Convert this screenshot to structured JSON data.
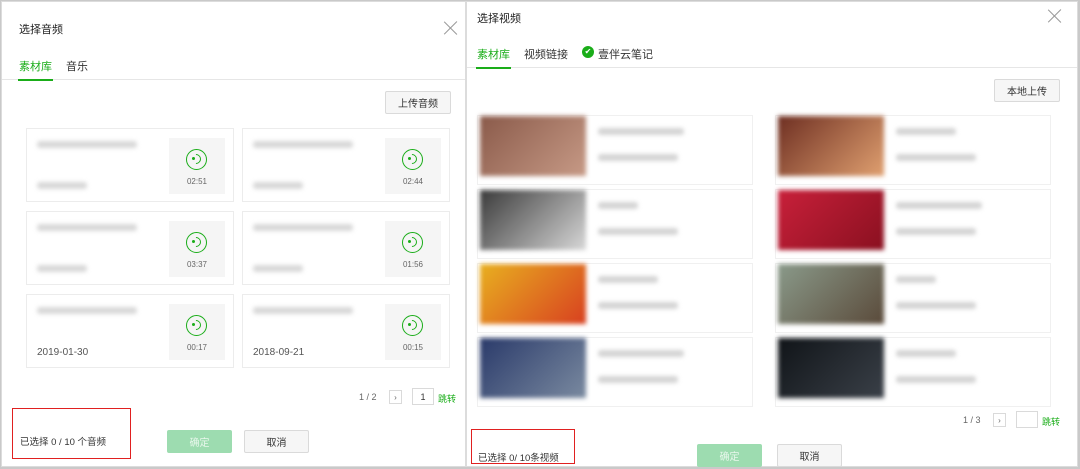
{
  "audio_dialog": {
    "title": "选择音频",
    "tabs": [
      {
        "label": "素材库",
        "active": true
      },
      {
        "label": "音乐",
        "active": false
      }
    ],
    "upload_label": "上传音频",
    "items": [
      {
        "duration": "02:51",
        "date": ""
      },
      {
        "duration": "02:44",
        "date": ""
      },
      {
        "duration": "03:37",
        "date": ""
      },
      {
        "duration": "01:56",
        "date": ""
      },
      {
        "duration": "00:17",
        "date": "2019-01-30"
      },
      {
        "duration": "00:15",
        "date": "2018-09-21"
      }
    ],
    "pager": {
      "text": "1 / 2",
      "next": "›",
      "page_input": "1",
      "jump": "跳转"
    },
    "selected_text": "已选择 0 / 10 个音频",
    "confirm_label": "确定",
    "cancel_label": "取消"
  },
  "video_dialog": {
    "title": "选择视频",
    "tabs": [
      {
        "label": "素材库",
        "active": true
      },
      {
        "label": "视频链接",
        "active": false
      },
      {
        "label": "壹伴云笔记",
        "active": false,
        "icon": "cloud-note-icon"
      }
    ],
    "note_icon_glyph": "✔",
    "upload_label": "本地上传",
    "items": [
      {
        "thumb_colors": [
          "#8a5a4a",
          "#c79a86"
        ]
      },
      {
        "thumb_colors": [
          "#6e2f22",
          "#e0a070"
        ]
      },
      {
        "thumb_colors": [
          "#3a3a3a",
          "#d8d8d8"
        ]
      },
      {
        "thumb_colors": [
          "#c8203a",
          "#8a1020"
        ]
      },
      {
        "thumb_colors": [
          "#e8b020",
          "#d84020"
        ]
      },
      {
        "thumb_colors": [
          "#8a9a8a",
          "#5a4a3a"
        ]
      },
      {
        "thumb_colors": [
          "#2a3a6a",
          "#7a8aa0"
        ]
      },
      {
        "thumb_colors": [
          "#101418",
          "#3a4048"
        ]
      }
    ],
    "pager": {
      "text": "1 / 3",
      "next": "›",
      "page_input": "",
      "jump": "跳转"
    },
    "selected_text": "已选择  0/ 10条视频",
    "confirm_label": "确定",
    "cancel_label": "取消"
  },
  "colors": {
    "accent": "#1aad19",
    "highlight_border": "#e02020"
  }
}
